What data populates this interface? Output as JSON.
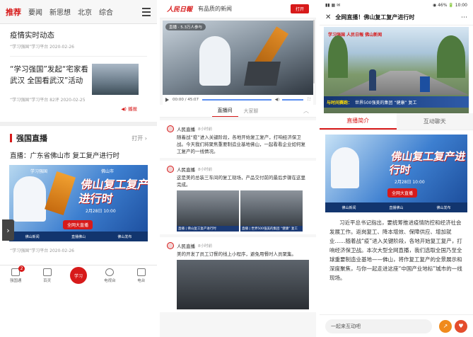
{
  "p1": {
    "tabs": [
      "推荐",
      "要闻",
      "新思想",
      "北京",
      "综合"
    ],
    "news1": {
      "title": "疫情实时动态",
      "meta": "“学习强国”学习平台  2020-02-26"
    },
    "news2": {
      "title": "“学习强国”发起“宅家看武汉 全国看武汉”活动",
      "meta": "“学习强国”学习平台  82评  2020-02-25",
      "badge": "播报"
    },
    "section": {
      "title": "强国直播",
      "open": "打开 ›"
    },
    "live_title": "直播：广东省佛山市 复工复产进行时",
    "poster": {
      "big": "佛山复工复产进行时",
      "date": "2月28日 10:00",
      "btn": "全网大直播",
      "brand1": "学习强国",
      "brand2": "佛山市",
      "foot": [
        "佛山新闻",
        "直播佛山",
        "佛山发布"
      ]
    },
    "meta_live": "“学习强国”学习平台  2020-02-26",
    "arrow": "›",
    "nav": [
      {
        "label": "强国通",
        "badge": "2"
      },
      {
        "label": "百灵",
        "badge": ""
      },
      {
        "label": "学习",
        "badge": ""
      },
      {
        "label": "电视台",
        "badge": ""
      },
      {
        "label": "电台",
        "badge": ""
      }
    ]
  },
  "p2": {
    "logo": "人民日報",
    "slogan": "有品质的新闻",
    "open_btn": "打开",
    "video_pill": "直播 · 5.3万人参与",
    "time": "00:00 / 45:07",
    "tabs": [
      "直播间",
      "大家聊"
    ],
    "chev": "︿",
    "posts": [
      {
        "name": "人民直播",
        "time": "8小时前",
        "text": "随着战“疫”进入关键阶段，各地开始复工复产，打响经济保卫战。今天我们将聚焦重要制造业基地佛山，一起看看企业如何复工复产的一线情况。"
      },
      {
        "name": "人民直播",
        "time": "8小时前",
        "text": "这是美的总装三车间的复工现场，产品交付前的最后步骤在这里完成。",
        "img1": "直播 | 佛山复工复产进行时",
        "img2": "直播 | 世界500强美的集团 “健康” 复工"
      },
      {
        "name": "人民直播",
        "time": "8小时前",
        "text": "美的开发了员工订餐的线上小程序，避免用餐时人员聚集。"
      }
    ]
  },
  "p3": {
    "status_left": "▮▮ ▦ ✉",
    "status_right": "◉ 46% 🔋 10:00",
    "title": "全网直播！佛山复工复产进行时",
    "hero_logos": "学习强国  人民日報  佛山新闻",
    "caption_tag": "与时间赛跑：",
    "caption": "世界500强美的集团 “健康” 复工",
    "tabs": [
      "直播简介",
      "互动聊天"
    ],
    "poster": {
      "big": "佛山复工复产进行时",
      "date": "2月28日 10:00",
      "btn": "全网大直播",
      "foot": [
        "佛山新闻",
        "直播佛山",
        "佛山发布"
      ]
    },
    "article": "习近平总书记指出，要统筹推进疫情防控和经济社会发展工作。返岗复工、降本增效、保障供应、增加就业……随着战“疫”进入关键阶段，各地开始复工复产，打响经济保卫战。本次大型全网直播，我们选取全国乃至全球重要制造业基地——佛山，将作复工复产的全景展示和深度聚焦，与你一起走进这座“中国产业地标”城市的一线现场。",
    "input_placeholder": "一起来互动吧"
  },
  "colors": {
    "accent": "#d71a1a",
    "navy": "#12356e"
  }
}
